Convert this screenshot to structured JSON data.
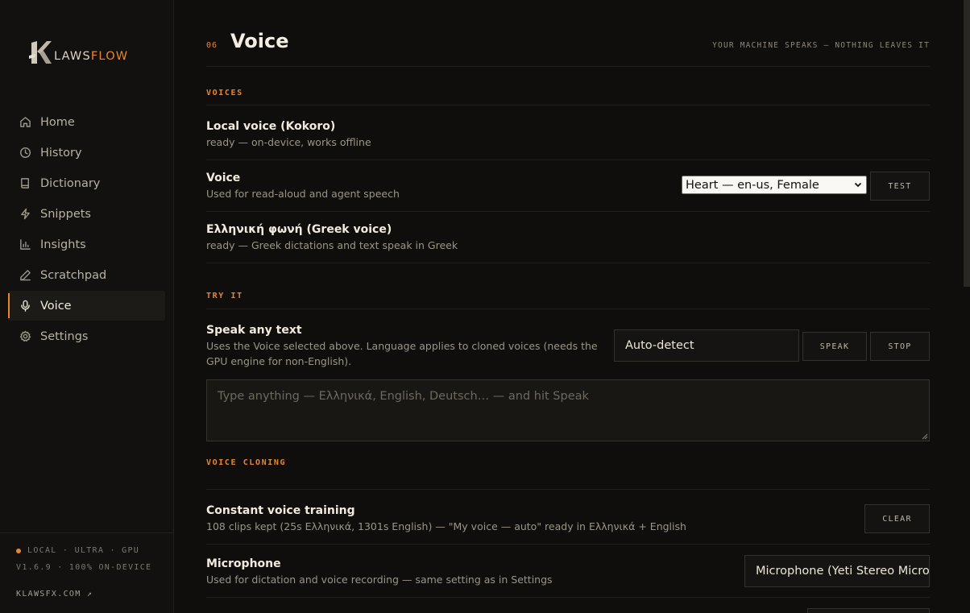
{
  "brand": {
    "k": "K",
    "laws": "LAWS",
    "flow": "FLOW"
  },
  "nav": [
    {
      "label": "Home",
      "icon": "home-icon"
    },
    {
      "label": "History",
      "icon": "clock-icon"
    },
    {
      "label": "Dictionary",
      "icon": "book-icon"
    },
    {
      "label": "Snippets",
      "icon": "bolt-icon"
    },
    {
      "label": "Insights",
      "icon": "bar-chart-icon"
    },
    {
      "label": "Scratchpad",
      "icon": "pen-icon"
    },
    {
      "label": "Voice",
      "icon": "mic-icon",
      "active": true
    },
    {
      "label": "Settings",
      "icon": "gear-icon"
    }
  ],
  "footer": {
    "status": "LOCAL · ULTRA · GPU",
    "version": "V1.6.9 · 100% ON-DEVICE",
    "site": "KLAWSFX.COM ↗"
  },
  "header": {
    "number": "06",
    "title": "Voice",
    "tagline": "YOUR MACHINE SPEAKS — NOTHING LEAVES IT"
  },
  "voices": {
    "label": "VOICES",
    "local": {
      "title": "Local voice (Kokoro)",
      "sub": "ready — on-device, works offline"
    },
    "voice": {
      "title": "Voice",
      "sub": "Used for read-aloud and agent speech",
      "selected": "Heart — en-us, Female",
      "test_label": "TEST"
    },
    "greek": {
      "title": "Ελληνική φωνή (Greek voice)",
      "sub": "ready — Greek dictations and text speak in Greek"
    }
  },
  "try_it": {
    "label": "TRY IT",
    "title": "Speak any text",
    "sub_line1": "Uses the Voice selected above. Language applies to cloned voices (needs the",
    "sub_line2": "GPU engine for non-English).",
    "language": "Auto-detect",
    "speak_label": "SPEAK",
    "stop_label": "STOP",
    "placeholder": "Type anything — Ελληνικά, English, Deutsch… — and hit Speak"
  },
  "cloning": {
    "label": "VOICE CLONING",
    "training": {
      "title": "Constant voice training",
      "sub": "108 clips kept (25s Ελληνικά, 1301s English) — \"My voice — auto\" ready in Ελληνικά + English",
      "clear_label": "CLEAR"
    },
    "microphone": {
      "title": "Microphone",
      "sub": "Used for dictation and voice recording — same setting as in Settings",
      "value": "Microphone (Yeti Stereo Microphone)"
    }
  },
  "colors": {
    "accent": "#e8862f",
    "background": "#0f0e0c",
    "sidebar": "#121110"
  }
}
